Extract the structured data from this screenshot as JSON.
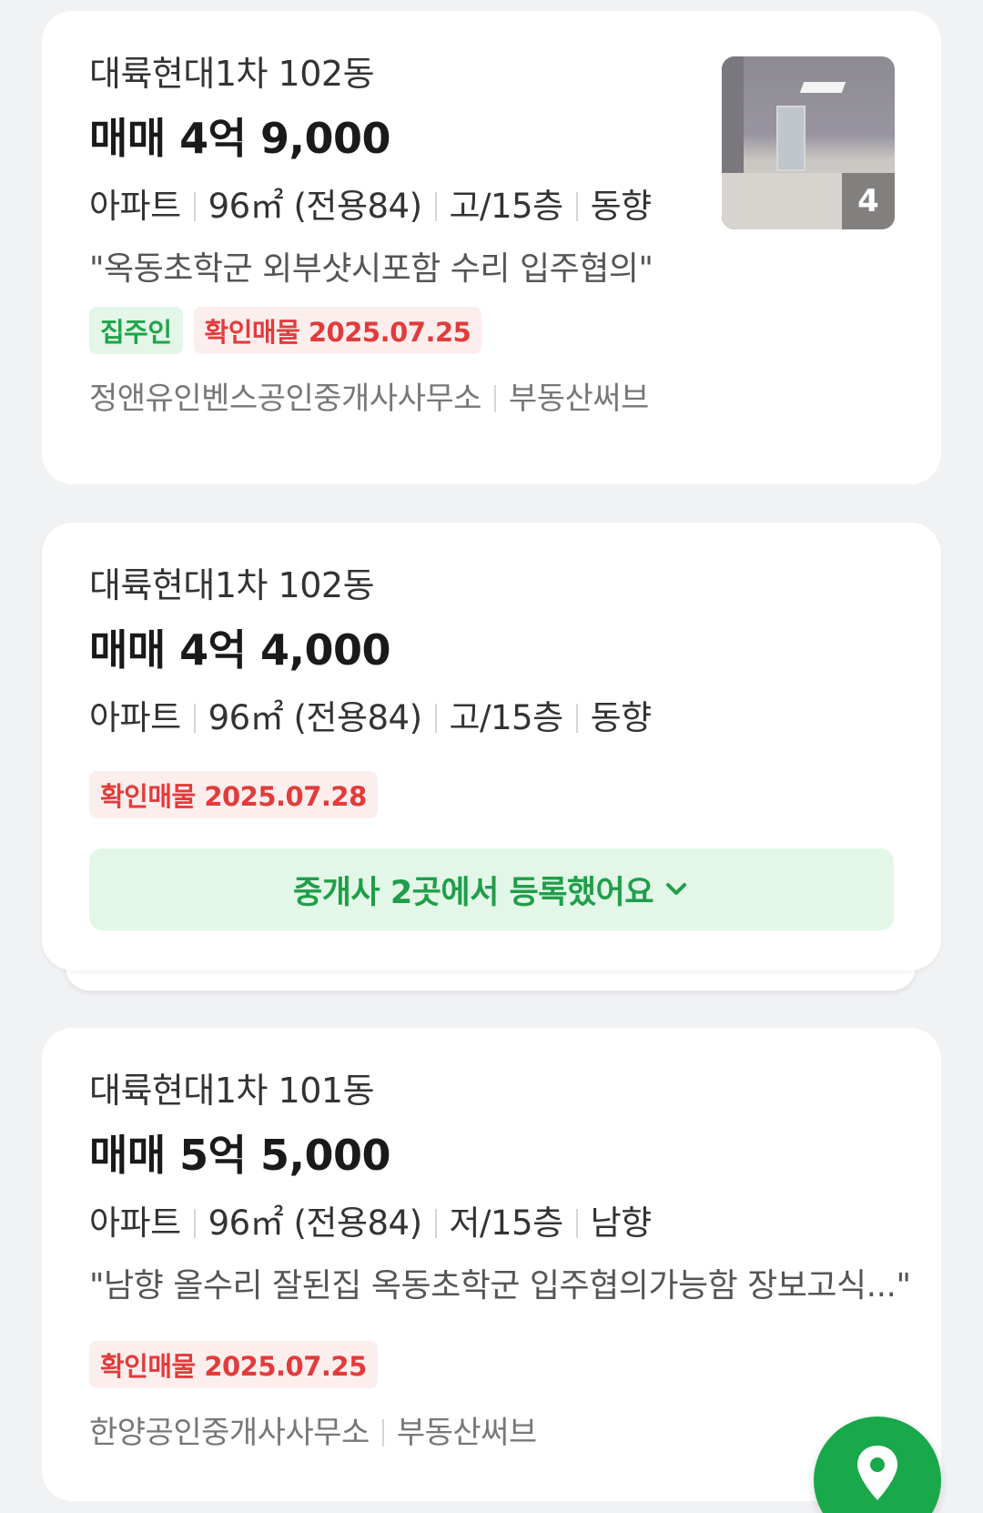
{
  "listings": [
    {
      "complex": "대륙현대1차 102동",
      "price": "매매 4억 9,000",
      "spec": {
        "type": "아파트",
        "area": "96㎡ (전용84)",
        "floor": "고/15층",
        "direction": "동향"
      },
      "description": "\"옥동초학군 외부샷시포함 수리 입주협의\"",
      "tags": {
        "owner": "집주인",
        "verified": "확인매물 2025.07.25"
      },
      "agency": {
        "name": "정앤유인벤스공인중개사사무소",
        "source": "부동산써브"
      },
      "photo_count": "4"
    },
    {
      "complex": "대륙현대1차 102동",
      "price": "매매 4억 4,000",
      "spec": {
        "type": "아파트",
        "area": "96㎡ (전용84)",
        "floor": "고/15층",
        "direction": "동향"
      },
      "tags": {
        "verified": "확인매물 2025.07.28"
      },
      "agents_button": "중개사 2곳에서 등록했어요"
    },
    {
      "complex": "대륙현대1차 101동",
      "price": "매매 5억 5,000",
      "spec": {
        "type": "아파트",
        "area": "96㎡ (전용84)",
        "floor": "저/15층",
        "direction": "남향"
      },
      "description": "\"남향 올수리 잘된집 옥동초학군 입주협의가능함 장보고식...\"",
      "tags": {
        "verified": "확인매물 2025.07.25"
      },
      "agency": {
        "name": "한양공인중개사사무소",
        "source": "부동산써브"
      }
    }
  ],
  "fab": {
    "icon": "map-pin-icon"
  },
  "colors": {
    "accent_green": "#19a84a",
    "verified_red": "#e23b3b",
    "owner_green": "#1ea54a"
  }
}
